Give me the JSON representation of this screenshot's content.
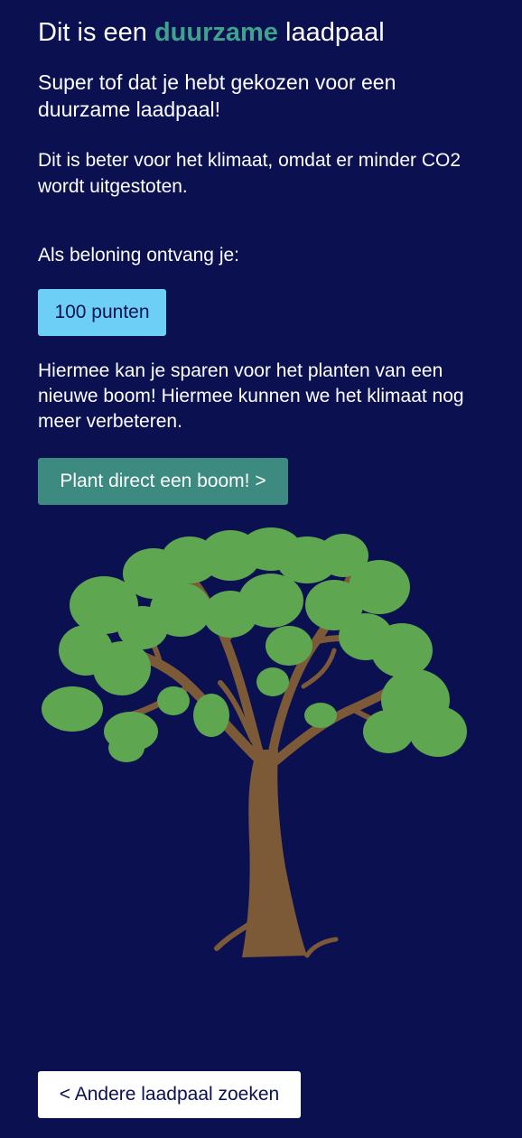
{
  "header": {
    "title_prefix": "Dit is een ",
    "title_highlight": "duurzame",
    "title_suffix": " laadpaal"
  },
  "content": {
    "intro": "Super tof dat je hebt gekozen voor een duurzame laadpaal!",
    "reason": "Dit is beter voor het klimaat, omdat er minder CO2 wordt uitgestoten.",
    "reward_label": "Als beloning ontvang je:",
    "points_badge": "100 punten",
    "explanation": "Hiermee kan je sparen voor het planten van een nieuwe boom! Hiermee kunnen we het klimaat nog meer verbeteren."
  },
  "actions": {
    "plant_tree_label": "Plant direct een boom! >",
    "back_label": "< Andere laadpaal zoeken"
  },
  "illustration": {
    "icon": "tree-illustration",
    "foliage_color": "#5ea64f",
    "trunk_color": "#7c5a38"
  },
  "theme": {
    "background": "#0a1050",
    "accent": "#3fa38c",
    "badge": "#6dcff6",
    "button": "#3d8a80"
  }
}
